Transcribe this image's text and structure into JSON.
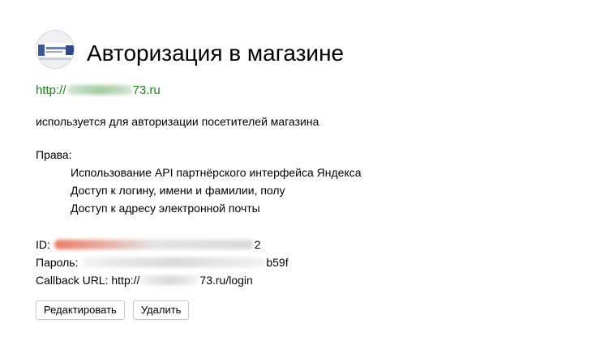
{
  "app": {
    "title": "Авторизация в магазине",
    "url_prefix": "http://",
    "url_suffix": "73.ru",
    "description": "используется для авторизации посетителей магазина"
  },
  "rights": {
    "label": "Права:",
    "items": [
      "Использование API партнёрского интерфейса Яндекса",
      "Доступ к логину, имени и фамилии, полу",
      "Доступ к адресу электронной почты"
    ]
  },
  "credentials": {
    "id_label": "ID:",
    "id_value_visible": "2",
    "password_label": "Пароль:",
    "password_value_visible": "b59f",
    "callback_label": "Callback URL:",
    "callback_prefix": "http://",
    "callback_suffix": "73.ru/login"
  },
  "actions": {
    "edit_label": "Редактировать",
    "delete_label": "Удалить"
  },
  "colors": {
    "link_green": "#208020",
    "button_border": "#c8c8c8"
  },
  "icons": {
    "app_logo": "app-logo-icon"
  }
}
